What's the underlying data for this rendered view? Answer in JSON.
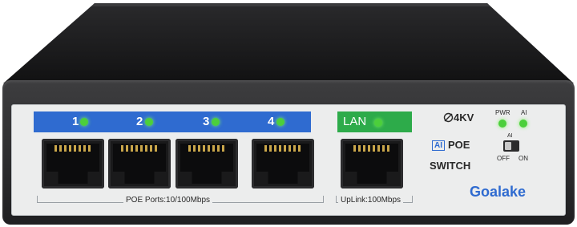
{
  "device": {
    "ports": [
      "1",
      "2",
      "3",
      "4"
    ],
    "lan_label": "LAN",
    "poe_ports_label": "POE Ports:10/100Mbps",
    "uplink_label": "UpLink:100Mbps",
    "surge_label": "4KV",
    "ai_badge": "AI",
    "poe_label": "POE",
    "switch_label": "SWITCH",
    "pwr_label": "PWR",
    "ai_led_label": "AI",
    "toggle_title": "AI",
    "toggle_off": "OFF",
    "toggle_on": "ON",
    "brand": "Goalake",
    "colors": {
      "port_bar": "#2f6bd0",
      "lan_bar": "#2dab4a",
      "led": "#4ccf3b",
      "brand": "#2f6bd0"
    }
  }
}
